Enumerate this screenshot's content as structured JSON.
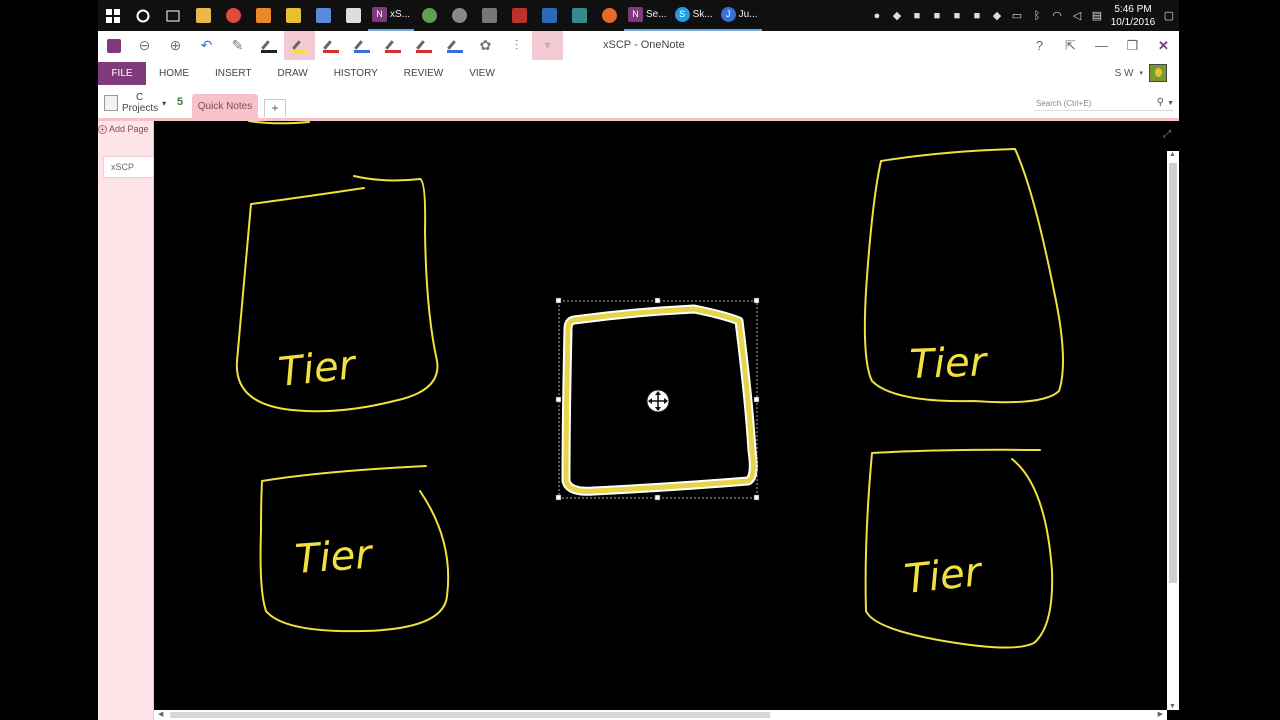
{
  "taskbar": {
    "apps": [
      {
        "label": "xS...",
        "color": "#80397b",
        "glyph": "N"
      },
      {
        "label": "Se...",
        "color": "#80397b",
        "glyph": "N"
      },
      {
        "label": "Sk...",
        "color": "#1ea0e0",
        "glyph": "S"
      },
      {
        "label": "Ju...",
        "color": "#3a6fd8",
        "glyph": "J"
      }
    ],
    "clock_time": "5:46 PM",
    "clock_date": "10/1/2016"
  },
  "window": {
    "title": "xSCP - OneNote",
    "controls": {
      "help": "?",
      "fullscreen": "⇱",
      "minimize": "—",
      "restore": "❐",
      "close": "✕"
    }
  },
  "ribbon": {
    "file": "FILE",
    "tabs": [
      "HOME",
      "INSERT",
      "DRAW",
      "HISTORY",
      "REVIEW",
      "VIEW"
    ],
    "user_initials": "S W",
    "user_caret": "▾"
  },
  "pens": [
    {
      "color": "#222222",
      "selected": false
    },
    {
      "color": "#f0e040",
      "selected": true
    },
    {
      "color": "#d03030",
      "selected": false
    },
    {
      "color": "#3a6fd8",
      "selected": false
    },
    {
      "color": "#d03030",
      "selected": false
    },
    {
      "color": "#d03030",
      "selected": false
    },
    {
      "color": "#3a6fd8",
      "selected": false
    }
  ],
  "notebook": {
    "name_line1": "C",
    "name_line2": "Projects",
    "caret": "▾",
    "sync": "5"
  },
  "section": {
    "active_tab": "Quick Notes",
    "add": "+"
  },
  "search": {
    "placeholder": "Search (Ctrl+E)"
  },
  "pages": {
    "add_label": "Add Page",
    "items": [
      "xSCP"
    ]
  },
  "ink": {
    "color": "#f0e040",
    "handwriting": [
      "Tier",
      "Tier",
      "Tier",
      "Tier"
    ]
  }
}
